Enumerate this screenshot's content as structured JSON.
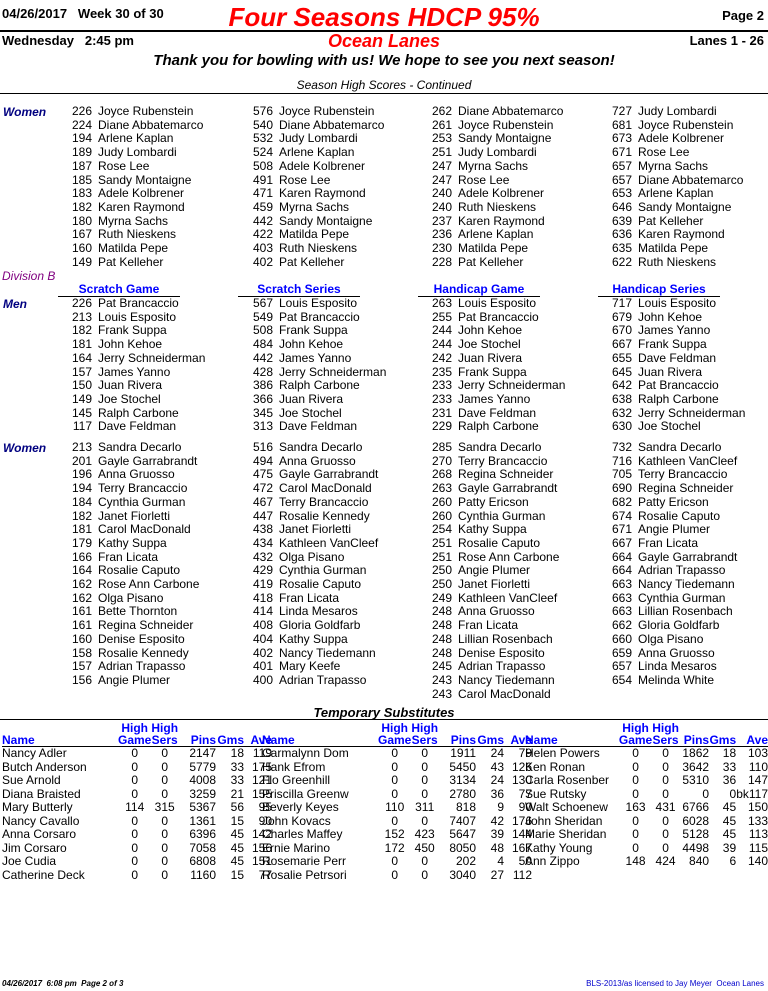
{
  "header": {
    "date": "04/26/2017",
    "week": "Week 30 of 30",
    "title": "Four Seasons HDCP 95%",
    "page": "Page 2",
    "day": "Wednesday",
    "time": "2:45 pm",
    "center": "Ocean Lanes",
    "lanes": "Lanes 1 - 26",
    "message": "Thank you for bowling with us! We hope to see you next season!",
    "section": "Season High Scores - Continued"
  },
  "divA_women": {
    "label": "Women",
    "columns": [
      [
        [
          "226",
          "Joyce Rubenstein"
        ],
        [
          "224",
          "Diane Abbatemarco"
        ],
        [
          "194",
          "Arlene Kaplan"
        ],
        [
          "189",
          "Judy Lombardi"
        ],
        [
          "187",
          "Rose Lee"
        ],
        [
          "185",
          "Sandy Montaigne"
        ],
        [
          "183",
          "Adele Kolbrener"
        ],
        [
          "182",
          "Karen Raymond"
        ],
        [
          "180",
          "Myrna Sachs"
        ],
        [
          "167",
          "Ruth Nieskens"
        ],
        [
          "160",
          "Matilda Pepe"
        ],
        [
          "149",
          "Pat Kelleher"
        ]
      ],
      [
        [
          "576",
          "Joyce Rubenstein"
        ],
        [
          "540",
          "Diane Abbatemarco"
        ],
        [
          "532",
          "Judy Lombardi"
        ],
        [
          "524",
          "Arlene Kaplan"
        ],
        [
          "508",
          "Adele Kolbrener"
        ],
        [
          "491",
          "Rose Lee"
        ],
        [
          "471",
          "Karen Raymond"
        ],
        [
          "459",
          "Myrna Sachs"
        ],
        [
          "442",
          "Sandy Montaigne"
        ],
        [
          "422",
          "Matilda Pepe"
        ],
        [
          "403",
          "Ruth Nieskens"
        ],
        [
          "402",
          "Pat Kelleher"
        ]
      ],
      [
        [
          "262",
          "Diane Abbatemarco"
        ],
        [
          "261",
          "Joyce Rubenstein"
        ],
        [
          "253",
          "Sandy Montaigne"
        ],
        [
          "251",
          "Judy Lombardi"
        ],
        [
          "247",
          "Myrna Sachs"
        ],
        [
          "247",
          "Rose Lee"
        ],
        [
          "240",
          "Adele Kolbrener"
        ],
        [
          "240",
          "Ruth Nieskens"
        ],
        [
          "237",
          "Karen Raymond"
        ],
        [
          "236",
          "Arlene Kaplan"
        ],
        [
          "230",
          "Matilda Pepe"
        ],
        [
          "228",
          "Pat Kelleher"
        ]
      ],
      [
        [
          "727",
          "Judy Lombardi"
        ],
        [
          "681",
          "Joyce Rubenstein"
        ],
        [
          "673",
          "Adele Kolbrener"
        ],
        [
          "671",
          "Rose Lee"
        ],
        [
          "657",
          "Myrna Sachs"
        ],
        [
          "657",
          "Diane Abbatemarco"
        ],
        [
          "653",
          "Arlene Kaplan"
        ],
        [
          "646",
          "Sandy Montaigne"
        ],
        [
          "639",
          "Pat Kelleher"
        ],
        [
          "636",
          "Karen Raymond"
        ],
        [
          "635",
          "Matilda Pepe"
        ],
        [
          "622",
          "Ruth Nieskens"
        ]
      ]
    ]
  },
  "divB": {
    "label": "Division B",
    "headings": [
      "Scratch Game",
      "Scratch Series",
      "Handicap Game",
      "Handicap Series"
    ],
    "men": {
      "label": "Men",
      "columns": [
        [
          [
            "226",
            "Pat Brancaccio"
          ],
          [
            "213",
            "Louis Esposito"
          ],
          [
            "182",
            "Frank Suppa"
          ],
          [
            "181",
            "John Kehoe"
          ],
          [
            "164",
            "Jerry Schneiderman"
          ],
          [
            "157",
            "James Yanno"
          ],
          [
            "150",
            "Juan Rivera"
          ],
          [
            "149",
            "Joe Stochel"
          ],
          [
            "145",
            "Ralph Carbone"
          ],
          [
            "117",
            "Dave Feldman"
          ]
        ],
        [
          [
            "567",
            "Louis Esposito"
          ],
          [
            "549",
            "Pat Brancaccio"
          ],
          [
            "508",
            "Frank Suppa"
          ],
          [
            "484",
            "John Kehoe"
          ],
          [
            "442",
            "James Yanno"
          ],
          [
            "428",
            "Jerry Schneiderman"
          ],
          [
            "386",
            "Ralph Carbone"
          ],
          [
            "366",
            "Juan Rivera"
          ],
          [
            "345",
            "Joe Stochel"
          ],
          [
            "313",
            "Dave Feldman"
          ]
        ],
        [
          [
            "263",
            "Louis Esposito"
          ],
          [
            "255",
            "Pat Brancaccio"
          ],
          [
            "244",
            "John Kehoe"
          ],
          [
            "244",
            "Joe Stochel"
          ],
          [
            "242",
            "Juan Rivera"
          ],
          [
            "235",
            "Frank Suppa"
          ],
          [
            "233",
            "Jerry Schneiderman"
          ],
          [
            "233",
            "James Yanno"
          ],
          [
            "231",
            "Dave Feldman"
          ],
          [
            "229",
            "Ralph Carbone"
          ]
        ],
        [
          [
            "717",
            "Louis Esposito"
          ],
          [
            "679",
            "John Kehoe"
          ],
          [
            "670",
            "James Yanno"
          ],
          [
            "667",
            "Frank Suppa"
          ],
          [
            "655",
            "Dave Feldman"
          ],
          [
            "645",
            "Juan Rivera"
          ],
          [
            "642",
            "Pat Brancaccio"
          ],
          [
            "638",
            "Ralph Carbone"
          ],
          [
            "632",
            "Jerry Schneiderman"
          ],
          [
            "630",
            "Joe Stochel"
          ]
        ]
      ]
    },
    "women": {
      "label": "Women",
      "columns": [
        [
          [
            "213",
            "Sandra Decarlo"
          ],
          [
            "201",
            "Gayle Garrabrandt"
          ],
          [
            "196",
            "Anna Gruosso"
          ],
          [
            "194",
            "Terry Brancaccio"
          ],
          [
            "184",
            "Cynthia Gurman"
          ],
          [
            "182",
            "Janet Fiorletti"
          ],
          [
            "181",
            "Carol MacDonald"
          ],
          [
            "179",
            "Kathy Suppa"
          ],
          [
            "166",
            "Fran Licata"
          ],
          [
            "164",
            "Rosalie Caputo"
          ],
          [
            "162",
            "Rose Ann Carbone"
          ],
          [
            "162",
            "Olga Pisano"
          ],
          [
            "161",
            "Bette Thornton"
          ],
          [
            "161",
            "Regina Schneider"
          ],
          [
            "160",
            "Denise Esposito"
          ],
          [
            "158",
            "Rosalie Kennedy"
          ],
          [
            "157",
            "Adrian Trapasso"
          ],
          [
            "156",
            "Angie Plumer"
          ]
        ],
        [
          [
            "516",
            "Sandra Decarlo"
          ],
          [
            "494",
            "Anna Gruosso"
          ],
          [
            "475",
            "Gayle Garrabrandt"
          ],
          [
            "472",
            "Carol MacDonald"
          ],
          [
            "467",
            "Terry Brancaccio"
          ],
          [
            "447",
            "Rosalie Kennedy"
          ],
          [
            "438",
            "Janet Fiorletti"
          ],
          [
            "434",
            "Kathleen VanCleef"
          ],
          [
            "432",
            "Olga Pisano"
          ],
          [
            "429",
            "Cynthia Gurman"
          ],
          [
            "419",
            "Rosalie Caputo"
          ],
          [
            "418",
            "Fran Licata"
          ],
          [
            "414",
            "Linda Mesaros"
          ],
          [
            "408",
            "Gloria Goldfarb"
          ],
          [
            "404",
            "Kathy Suppa"
          ],
          [
            "402",
            "Nancy Tiedemann"
          ],
          [
            "401",
            "Mary Keefe"
          ],
          [
            "400",
            "Adrian Trapasso"
          ]
        ],
        [
          [
            "285",
            "Sandra Decarlo"
          ],
          [
            "270",
            "Terry Brancaccio"
          ],
          [
            "268",
            "Regina Schneider"
          ],
          [
            "263",
            "Gayle Garrabrandt"
          ],
          [
            "260",
            "Patty Ericson"
          ],
          [
            "260",
            "Cynthia Gurman"
          ],
          [
            "254",
            "Kathy Suppa"
          ],
          [
            "251",
            "Rosalie Caputo"
          ],
          [
            "251",
            "Rose Ann Carbone"
          ],
          [
            "250",
            "Angie Plumer"
          ],
          [
            "250",
            "Janet Fiorletti"
          ],
          [
            "249",
            "Kathleen VanCleef"
          ],
          [
            "248",
            "Anna Gruosso"
          ],
          [
            "248",
            "Fran Licata"
          ],
          [
            "248",
            "Lillian Rosenbach"
          ],
          [
            "248",
            "Denise Esposito"
          ],
          [
            "245",
            "Adrian Trapasso"
          ],
          [
            "243",
            "Nancy Tiedemann"
          ],
          [
            "243",
            "Carol MacDonald"
          ]
        ],
        [
          [
            "732",
            "Sandra Decarlo"
          ],
          [
            "716",
            "Kathleen VanCleef"
          ],
          [
            "705",
            "Terry Brancaccio"
          ],
          [
            "690",
            "Regina Schneider"
          ],
          [
            "682",
            "Patty Ericson"
          ],
          [
            "674",
            "Rosalie Caputo"
          ],
          [
            "671",
            "Angie Plumer"
          ],
          [
            "667",
            "Fran Licata"
          ],
          [
            "664",
            "Gayle Garrabrandt"
          ],
          [
            "664",
            "Adrian Trapasso"
          ],
          [
            "663",
            "Nancy Tiedemann"
          ],
          [
            "663",
            "Cynthia Gurman"
          ],
          [
            "663",
            "Lillian Rosenbach"
          ],
          [
            "662",
            "Gloria Goldfarb"
          ],
          [
            "660",
            "Olga Pisano"
          ],
          [
            "659",
            "Anna Gruosso"
          ],
          [
            "657",
            "Linda Mesaros"
          ],
          [
            "654",
            "Melinda White"
          ]
        ]
      ]
    }
  },
  "subs": {
    "title": "Temporary Substitutes",
    "head_top": [
      "High",
      "High"
    ],
    "head": [
      "Name",
      "Game",
      "Sers",
      "Pins",
      "Gms",
      "Ave"
    ],
    "columns": [
      [
        [
          "Nancy Adler",
          "0",
          "0",
          "2147",
          "18",
          "119"
        ],
        [
          "Butch Anderson",
          "0",
          "0",
          "5779",
          "33",
          "175"
        ],
        [
          "Sue Arnold",
          "0",
          "0",
          "4008",
          "33",
          "121"
        ],
        [
          "Diana Braisted",
          "0",
          "0",
          "3259",
          "21",
          "155"
        ],
        [
          "Mary Butterly",
          "114",
          "315",
          "5367",
          "56",
          "95"
        ],
        [
          "Nancy Cavallo",
          "0",
          "0",
          "1361",
          "15",
          "90"
        ],
        [
          "Anna Corsaro",
          "0",
          "0",
          "6396",
          "45",
          "142"
        ],
        [
          "Jim Corsaro",
          "0",
          "0",
          "7058",
          "45",
          "156"
        ],
        [
          "Joe Cudia",
          "0",
          "0",
          "6808",
          "45",
          "151"
        ],
        [
          "Catherine Deck",
          "0",
          "0",
          "1160",
          "15",
          "77"
        ]
      ],
      [
        [
          "Carmalynn Dom",
          "0",
          "0",
          "1911",
          "24",
          "79"
        ],
        [
          "Hank Efrom",
          "0",
          "0",
          "5450",
          "43",
          "126"
        ],
        [
          "Flo Greenhill",
          "0",
          "0",
          "3134",
          "24",
          "130"
        ],
        [
          "Priscilla Greenw",
          "0",
          "0",
          "2780",
          "36",
          "77"
        ],
        [
          "Beverly Keyes",
          "110",
          "311",
          "818",
          "9",
          "90"
        ],
        [
          "John Kovacs",
          "0",
          "0",
          "7407",
          "42",
          "176"
        ],
        [
          "Charles Maffey",
          "152",
          "423",
          "5647",
          "39",
          "144"
        ],
        [
          "Ernie Marino",
          "172",
          "450",
          "8050",
          "48",
          "167"
        ],
        [
          "Rosemarie Perr",
          "0",
          "0",
          "202",
          "4",
          "50"
        ],
        [
          "Rosalie Petrsori",
          "0",
          "0",
          "3040",
          "27",
          "112"
        ]
      ],
      [
        [
          "Helen Powers",
          "0",
          "0",
          "1862",
          "18",
          "103"
        ],
        [
          "Ken Ronan",
          "0",
          "0",
          "3642",
          "33",
          "110"
        ],
        [
          "Carla Rosenber",
          "0",
          "0",
          "5310",
          "36",
          "147"
        ],
        [
          "Sue Rutsky",
          "0",
          "0",
          "0",
          "0",
          "bk117"
        ],
        [
          "Walt Schoenew",
          "163",
          "431",
          "6766",
          "45",
          "150"
        ],
        [
          "John Sheridan",
          "0",
          "0",
          "6028",
          "45",
          "133"
        ],
        [
          "Marie Sheridan",
          "0",
          "0",
          "5128",
          "45",
          "113"
        ],
        [
          "Kathy Young",
          "0",
          "0",
          "4498",
          "39",
          "115"
        ],
        [
          "Ann Zippo",
          "148",
          "424",
          "840",
          "6",
          "140"
        ]
      ]
    ]
  },
  "footer": {
    "left": "04/26/2017  6:08 pm  Page 2 of 3",
    "right": "BLS-2013/as licensed to Jay Meyer  Ocean Lanes"
  }
}
